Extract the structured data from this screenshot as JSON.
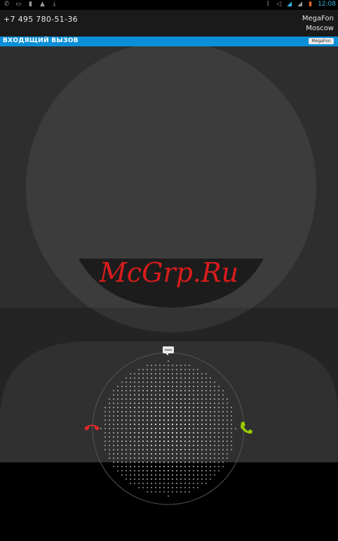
{
  "status_bar": {
    "time": "12:08",
    "left_icons": [
      "phone-icon",
      "screenshot-icon",
      "sim-icon",
      "warning-icon",
      "download-icon"
    ],
    "right_icons": [
      "bluetooth-icon",
      "mute-icon",
      "signal-icon",
      "signal-icon-2",
      "battery-icon"
    ]
  },
  "caller": {
    "number": "+7 495 780-51-36",
    "carrier_name": "MegaFon",
    "carrier_region": "Moscow"
  },
  "call_banner": {
    "label": "ВХОДЯЩИЙ ВЫЗОВ",
    "sim_label": "MegaFon"
  },
  "watermark": "McGrp.Ru",
  "colors": {
    "accent_blue": "#0a8fd8",
    "decline_red": "#e02a2a",
    "answer_green": "#99cc00",
    "watermark_red": "#d91c1c"
  },
  "glowpad": {
    "targets": [
      "message-icon",
      "decline-call-icon",
      "answer-call-icon"
    ]
  }
}
